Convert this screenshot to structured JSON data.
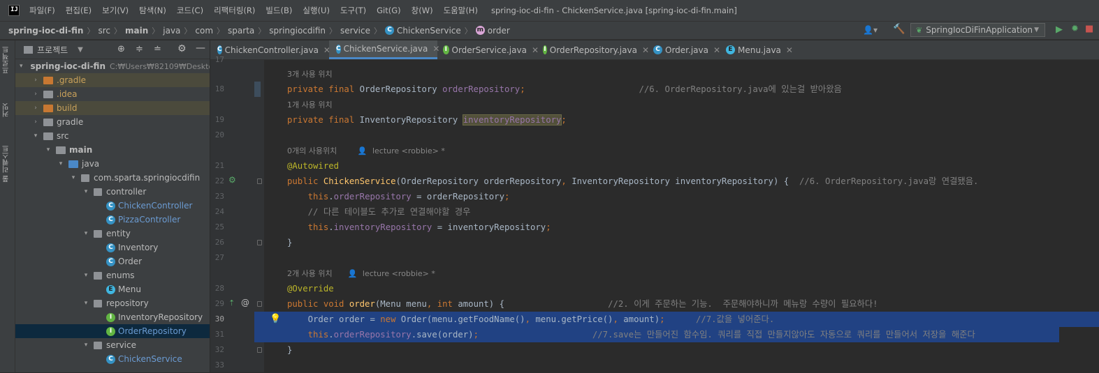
{
  "app_logo": "IJ",
  "menu": [
    "파일(F)",
    "편집(E)",
    "보기(V)",
    "탐색(N)",
    "코드(C)",
    "리팩터링(R)",
    "빌드(B)",
    "실행(U)",
    "도구(T)",
    "Git(G)",
    "창(W)",
    "도움말(H)"
  ],
  "window_title": "spring-ioc-di-fin - ChickenService.java [spring-ioc-di-fin.main]",
  "breadcrumb": [
    "spring-ioc-di-fin",
    "src",
    "main",
    "java",
    "com",
    "sparta",
    "springiocdifin",
    "service",
    "ChickenService",
    "order"
  ],
  "run_config": "SpringIocDiFinApplication",
  "left_tabs": [
    "프로젝트",
    "커밋",
    "풀 리퀘스트"
  ],
  "project_panel": {
    "title": "프로젝트",
    "tree": [
      {
        "label": "spring-ioc-di-fin",
        "path": "C:₩Users₩82109₩Deskto",
        "depth": 0,
        "type": "folder-gray",
        "arrow": "▾"
      },
      {
        "label": ".gradle",
        "depth": 1,
        "type": "folder-orange",
        "arrow": "›"
      },
      {
        "label": ".idea",
        "depth": 1,
        "type": "folder-gray",
        "arrow": "›"
      },
      {
        "label": "build",
        "depth": 1,
        "type": "folder-orange",
        "arrow": "›"
      },
      {
        "label": "gradle",
        "depth": 1,
        "type": "folder-gray",
        "arrow": "›"
      },
      {
        "label": "src",
        "depth": 1,
        "type": "folder-gray",
        "arrow": "▾"
      },
      {
        "label": "main",
        "depth": 2,
        "type": "folder-gray",
        "arrow": "▾"
      },
      {
        "label": "java",
        "depth": 3,
        "type": "folder-blue",
        "arrow": "▾"
      },
      {
        "label": "com.sparta.springiocdifin",
        "depth": 4,
        "type": "package",
        "arrow": "▾"
      },
      {
        "label": "controller",
        "depth": 5,
        "type": "package",
        "arrow": "▾"
      },
      {
        "label": "ChickenController",
        "depth": 6,
        "type": "class"
      },
      {
        "label": "PizzaController",
        "depth": 6,
        "type": "class"
      },
      {
        "label": "entity",
        "depth": 5,
        "type": "package",
        "arrow": "▾"
      },
      {
        "label": "Inventory",
        "depth": 6,
        "type": "class"
      },
      {
        "label": "Order",
        "depth": 6,
        "type": "class"
      },
      {
        "label": "enums",
        "depth": 5,
        "type": "package",
        "arrow": "▾"
      },
      {
        "label": "Menu",
        "depth": 6,
        "type": "enum"
      },
      {
        "label": "repository",
        "depth": 5,
        "type": "package",
        "arrow": "▾"
      },
      {
        "label": "InventoryRepository",
        "depth": 6,
        "type": "iface"
      },
      {
        "label": "OrderRepository",
        "depth": 6,
        "type": "iface"
      },
      {
        "label": "service",
        "depth": 5,
        "type": "package",
        "arrow": "▾"
      },
      {
        "label": "ChickenService",
        "depth": 6,
        "type": "class"
      }
    ]
  },
  "tabs": [
    {
      "label": "ChickenController.java",
      "icon": "C"
    },
    {
      "label": "ChickenService.java",
      "icon": "C"
    },
    {
      "label": "OrderService.java",
      "icon": "I"
    },
    {
      "label": "OrderRepository.java",
      "icon": "I"
    },
    {
      "label": "Order.java",
      "icon": "C"
    },
    {
      "label": "Menu.java",
      "icon": "E"
    }
  ],
  "usages": {
    "u3": "3개 사용 위치",
    "u1": "1개 사용 위치",
    "u0": "0개의 사용위치",
    "u2": "2개 사용 위치",
    "author": "lecture <robbie> *"
  },
  "code": {
    "n17": "17",
    "n18": "18",
    "n19": "19",
    "n20": "20",
    "n21": "21",
    "n22": "22",
    "n23": "23",
    "n24": "24",
    "n25": "25",
    "n26": "26",
    "n27": "27",
    "n28": "28",
    "n29": "29",
    "n30": "30",
    "n31": "31",
    "n32": "32",
    "n33": "33",
    "l18_kw": "private final ",
    "l18_type": "OrderRepository ",
    "l18_field": "orderRepository",
    "l18_end": ";",
    "l18_cm": "//6. OrderRepository.java에 있는걸 받아왔음",
    "l19_kw": "private final ",
    "l19_type": "InventoryRepository ",
    "l19_field": "inventoryRepository",
    "l19_end": ";",
    "l21": "@Autowired",
    "l22_kw": "public ",
    "l22_fn": "ChickenService",
    "l22_params": "(OrderRepository orderRepository",
    "l22_comma": ", ",
    "l22_params2": "InventoryRepository inventoryRepository) {  ",
    "l22_cm": "//6. OrderRepository.java랑 연결됐음.",
    "l23_kw": "this",
    "l23_dot": ".",
    "l23_field": "orderRepository",
    "l23_rest": " = orderRepository",
    "l23_end": ";",
    "l24": "// 다른 테이블도 추가로 연결해야할 경우",
    "l25_kw": "this",
    "l25_dot": ".",
    "l25_field": "inventoryRepository",
    "l25_rest": " = inventoryRepository",
    "l25_end": ";",
    "l26": "}",
    "l28": "@Override",
    "l29_kw": "public void ",
    "l29_fn": "order",
    "l29_a": "(Menu menu",
    "l29_comma": ", ",
    "l29_kw2": "int ",
    "l29_b": "amount) {",
    "l29_cm": "//2. 이게 주문하는 기능.  주문해야하니까 메뉴랑 수량이 필요하다!",
    "l30_a": "Order order = ",
    "l30_kw": "new ",
    "l30_b": "Order(menu.getFoodName()",
    "l30_c1": ", ",
    "l30_c": "menu.getPrice()",
    "l30_c2": ", ",
    "l30_d": "amount)",
    "l30_end": ";",
    "l30_cm": "//7.값을 넣어준다.",
    "l31_kw": "this",
    "l31_dot": ".",
    "l31_field": "orderRepository",
    "l31_rest": ".save(order)",
    "l31_end": ";",
    "l31_cm": "//7.save는 만들어진 함수임. 쿼리를 직접 만들지않아도 자동으로 쿼리를 만들어서 저장을 해준다",
    "l32": "}"
  }
}
